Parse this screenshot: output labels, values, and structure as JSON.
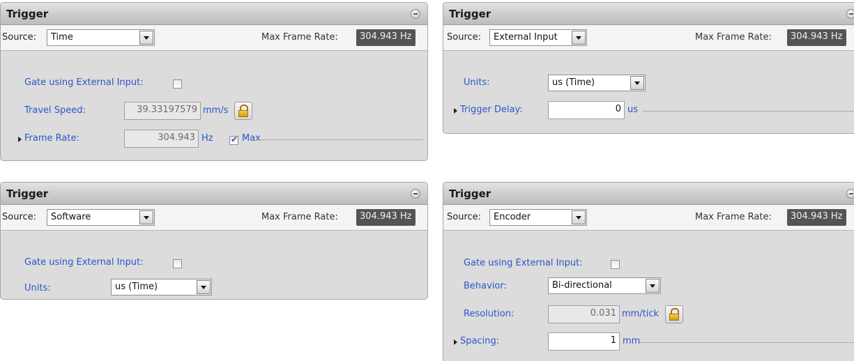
{
  "panels": [
    {
      "title": "Trigger",
      "source_label": "Source:",
      "source_value": "Time",
      "max_frame_rate_label": "Max Frame Rate:",
      "max_frame_rate_value": "304.943 Hz",
      "gate_label": "Gate using External Input:",
      "gate_checked": false,
      "travel_speed_label": "Travel Speed:",
      "travel_speed_value": "39.33197579",
      "travel_speed_unit": "mm/s",
      "frame_rate_label": "Frame Rate:",
      "frame_rate_value": "304.943",
      "frame_rate_unit": "Hz",
      "max_label": "Max",
      "max_checked": true
    },
    {
      "title": "Trigger",
      "source_label": "Source:",
      "source_value": "External Input",
      "max_frame_rate_label": "Max Frame Rate:",
      "max_frame_rate_value": "304.943 Hz",
      "units_label": "Units:",
      "units_value": "us (Time)",
      "trigger_delay_label": "Trigger Delay:",
      "trigger_delay_value": "0",
      "trigger_delay_unit": "us"
    },
    {
      "title": "Trigger",
      "source_label": "Source:",
      "source_value": "Software",
      "max_frame_rate_label": "Max Frame Rate:",
      "max_frame_rate_value": "304.943 Hz",
      "gate_label": "Gate using External Input:",
      "gate_checked": false,
      "units_label": "Units:",
      "units_value": "us (Time)"
    },
    {
      "title": "Trigger",
      "source_label": "Source:",
      "source_value": "Encoder",
      "max_frame_rate_label": "Max Frame Rate:",
      "max_frame_rate_value": "304.943 Hz",
      "gate_label": "Gate using External Input:",
      "gate_checked": false,
      "behavior_label": "Behavior:",
      "behavior_value": "Bi-directional",
      "resolution_label": "Resolution:",
      "resolution_value": "0.031",
      "resolution_unit": "mm/tick",
      "spacing_label": "Spacing:",
      "spacing_value": "1",
      "spacing_unit": "mm"
    }
  ],
  "colors": {
    "label_blue": "#2c55c8",
    "panel_bg": "#dcdcdc",
    "rate_badge_bg": "#545454"
  },
  "icons": {
    "collapse": "minus-circle-icon",
    "lock": "padlock-icon",
    "expand": "triangle-right-icon",
    "dropdown": "chevron-down-icon"
  }
}
